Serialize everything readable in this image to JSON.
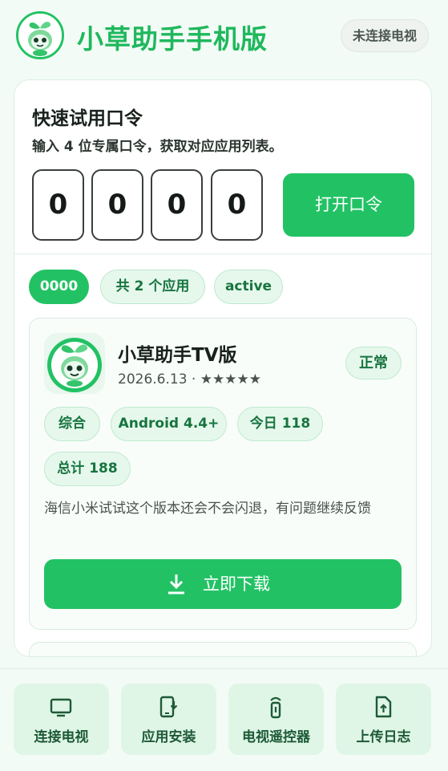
{
  "header": {
    "title": "小草助手手机版",
    "connection_status": "未连接电视"
  },
  "code_panel": {
    "title": "快速试用口令",
    "subtitle": "输入 4 位专属口令，获取对应应用列表。",
    "digits": [
      "0",
      "0",
      "0",
      "0"
    ],
    "open_button": "打开口令"
  },
  "result_chips": {
    "code": "0000",
    "count": "共 2 个应用",
    "status": "active"
  },
  "app": {
    "name": "小草助手TV版",
    "meta": "2026.6.13 · ★★★★★",
    "status": "正常",
    "tags": [
      "综合",
      "Android 4.4+",
      "今日 118",
      "总计 188"
    ],
    "description": "海信小米试试这个版本还会不会闪退，有问题继续反馈",
    "download_button": "立即下载"
  },
  "bottom_nav": {
    "items": [
      {
        "label": "连接电视",
        "icon": "tv-icon"
      },
      {
        "label": "应用安装",
        "icon": "phone-install-icon"
      },
      {
        "label": "电视遥控器",
        "icon": "remote-icon"
      },
      {
        "label": "上传日志",
        "icon": "upload-file-icon"
      }
    ]
  },
  "colors": {
    "accent": "#22c264",
    "chip_bg": "#e6f8ec",
    "chip_text": "#17743f"
  }
}
